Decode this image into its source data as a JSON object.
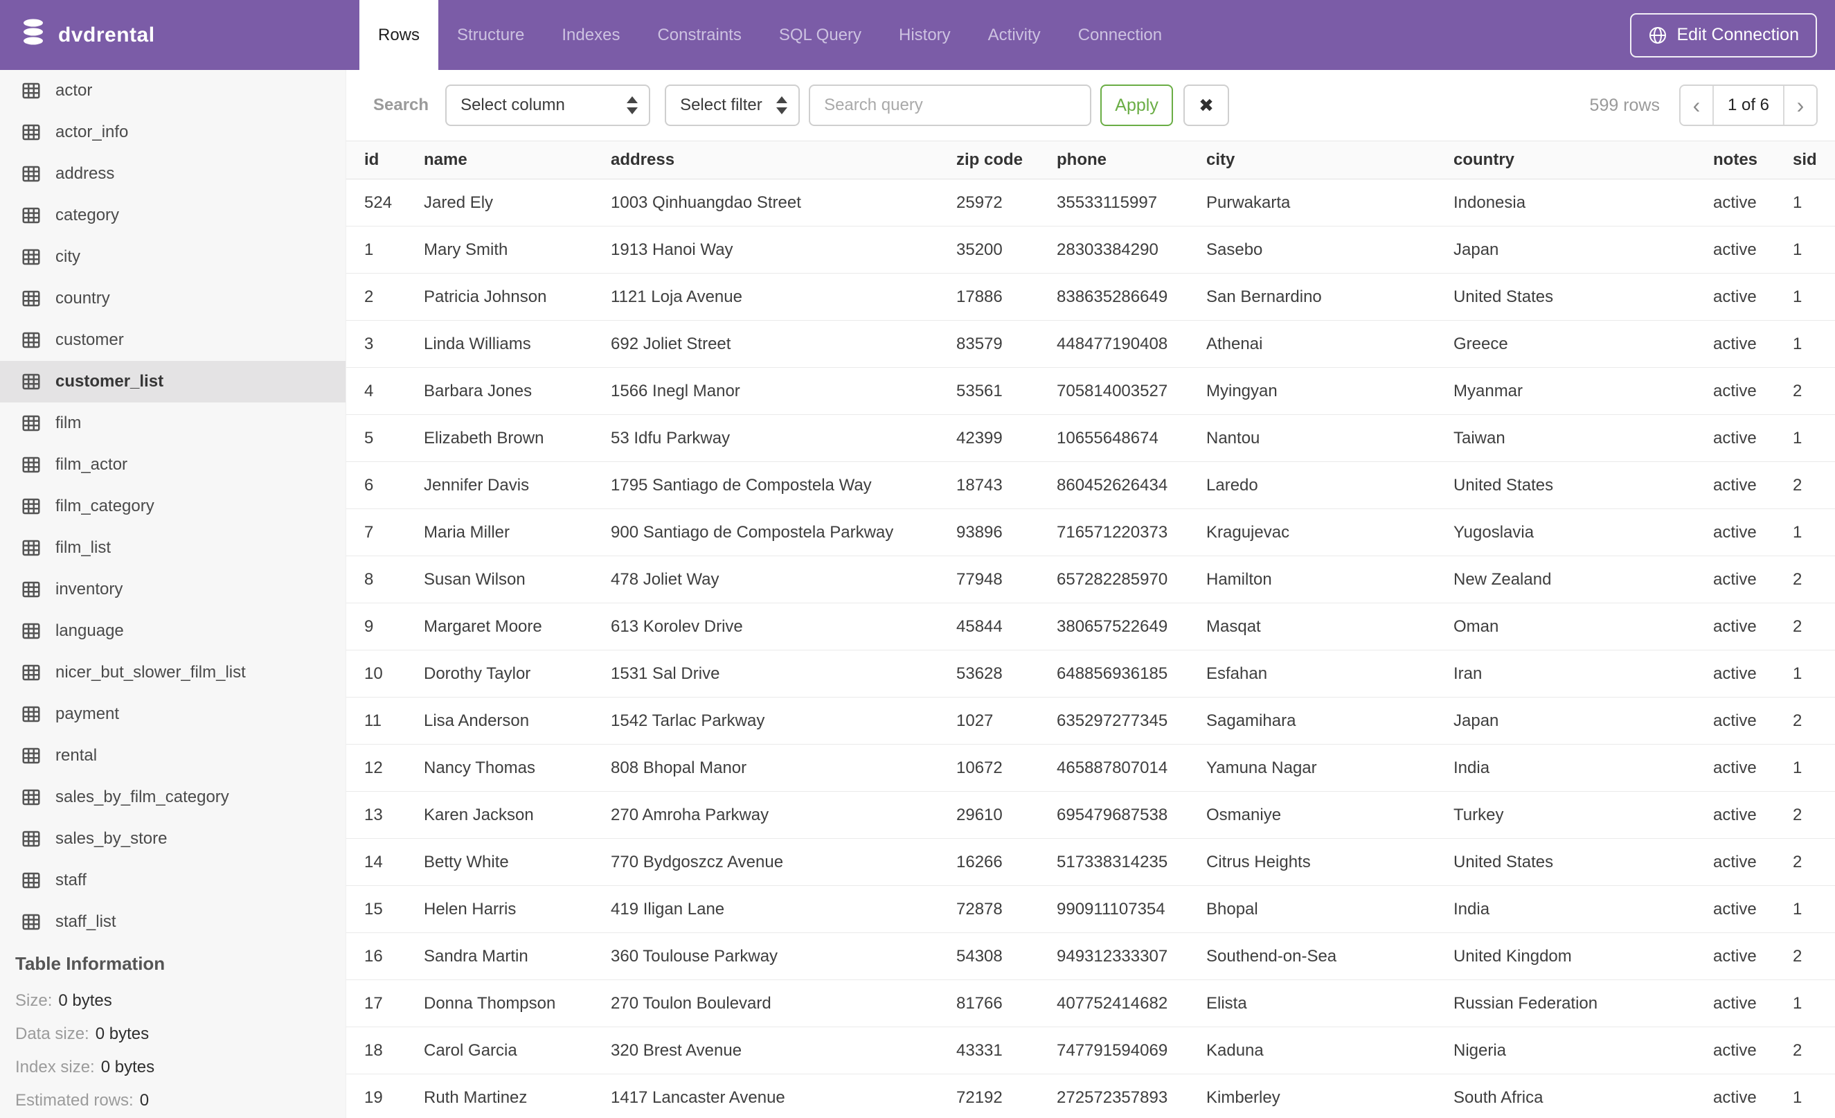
{
  "app": {
    "database_name": "dvdrental"
  },
  "colors": {
    "brand_purple": "#7b5ca7",
    "accent_green": "#6aad45"
  },
  "nav": {
    "tabs": [
      {
        "label": "Rows",
        "active": true
      },
      {
        "label": "Structure",
        "active": false
      },
      {
        "label": "Indexes",
        "active": false
      },
      {
        "label": "Constraints",
        "active": false
      },
      {
        "label": "SQL Query",
        "active": false
      },
      {
        "label": "History",
        "active": false
      },
      {
        "label": "Activity",
        "active": false
      },
      {
        "label": "Connection",
        "active": false
      }
    ],
    "edit_connection_label": "Edit Connection"
  },
  "sidebar": {
    "tables": [
      {
        "label": "actor",
        "selected": false
      },
      {
        "label": "actor_info",
        "selected": false
      },
      {
        "label": "address",
        "selected": false
      },
      {
        "label": "category",
        "selected": false
      },
      {
        "label": "city",
        "selected": false
      },
      {
        "label": "country",
        "selected": false
      },
      {
        "label": "customer",
        "selected": false
      },
      {
        "label": "customer_list",
        "selected": true
      },
      {
        "label": "film",
        "selected": false
      },
      {
        "label": "film_actor",
        "selected": false
      },
      {
        "label": "film_category",
        "selected": false
      },
      {
        "label": "film_list",
        "selected": false
      },
      {
        "label": "inventory",
        "selected": false
      },
      {
        "label": "language",
        "selected": false
      },
      {
        "label": "nicer_but_slower_film_list",
        "selected": false
      },
      {
        "label": "payment",
        "selected": false
      },
      {
        "label": "rental",
        "selected": false
      },
      {
        "label": "sales_by_film_category",
        "selected": false
      },
      {
        "label": "sales_by_store",
        "selected": false
      },
      {
        "label": "staff",
        "selected": false
      },
      {
        "label": "staff_list",
        "selected": false
      }
    ],
    "info": {
      "title": "Table Information",
      "stats": [
        {
          "label": "Size:",
          "value": "0 bytes"
        },
        {
          "label": "Data size:",
          "value": "0 bytes"
        },
        {
          "label": "Index size:",
          "value": "0 bytes"
        },
        {
          "label": "Estimated rows:",
          "value": "0"
        }
      ]
    }
  },
  "toolbar": {
    "search_label": "Search",
    "column_select_value": "Select column",
    "filter_select_value": "Select filter",
    "query_placeholder": "Search query",
    "apply_label": "Apply",
    "clear_icon": "✖",
    "rows_count": "599 rows",
    "pager": {
      "prev": "‹",
      "current": "1 of 6",
      "next": "›"
    }
  },
  "table": {
    "columns": [
      "id",
      "name",
      "address",
      "zip code",
      "phone",
      "city",
      "country",
      "notes",
      "sid"
    ],
    "rows": [
      {
        "id": "524",
        "name": "Jared Ely",
        "address": "1003 Qinhuangdao Street",
        "zip": "25972",
        "phone": "35533115997",
        "city": "Purwakarta",
        "country": "Indonesia",
        "notes": "active",
        "sid": "1"
      },
      {
        "id": "1",
        "name": "Mary Smith",
        "address": "1913 Hanoi Way",
        "zip": "35200",
        "phone": "28303384290",
        "city": "Sasebo",
        "country": "Japan",
        "notes": "active",
        "sid": "1"
      },
      {
        "id": "2",
        "name": "Patricia Johnson",
        "address": "1121 Loja Avenue",
        "zip": "17886",
        "phone": "838635286649",
        "city": "San Bernardino",
        "country": "United States",
        "notes": "active",
        "sid": "1"
      },
      {
        "id": "3",
        "name": "Linda Williams",
        "address": "692 Joliet Street",
        "zip": "83579",
        "phone": "448477190408",
        "city": "Athenai",
        "country": "Greece",
        "notes": "active",
        "sid": "1"
      },
      {
        "id": "4",
        "name": "Barbara Jones",
        "address": "1566 Inegl Manor",
        "zip": "53561",
        "phone": "705814003527",
        "city": "Myingyan",
        "country": "Myanmar",
        "notes": "active",
        "sid": "2"
      },
      {
        "id": "5",
        "name": "Elizabeth Brown",
        "address": "53 Idfu Parkway",
        "zip": "42399",
        "phone": "10655648674",
        "city": "Nantou",
        "country": "Taiwan",
        "notes": "active",
        "sid": "1"
      },
      {
        "id": "6",
        "name": "Jennifer Davis",
        "address": "1795 Santiago de Compostela Way",
        "zip": "18743",
        "phone": "860452626434",
        "city": "Laredo",
        "country": "United States",
        "notes": "active",
        "sid": "2"
      },
      {
        "id": "7",
        "name": "Maria Miller",
        "address": "900 Santiago de Compostela Parkway",
        "zip": "93896",
        "phone": "716571220373",
        "city": "Kragujevac",
        "country": "Yugoslavia",
        "notes": "active",
        "sid": "1"
      },
      {
        "id": "8",
        "name": "Susan Wilson",
        "address": "478 Joliet Way",
        "zip": "77948",
        "phone": "657282285970",
        "city": "Hamilton",
        "country": "New Zealand",
        "notes": "active",
        "sid": "2"
      },
      {
        "id": "9",
        "name": "Margaret Moore",
        "address": "613 Korolev Drive",
        "zip": "45844",
        "phone": "380657522649",
        "city": "Masqat",
        "country": "Oman",
        "notes": "active",
        "sid": "2"
      },
      {
        "id": "10",
        "name": "Dorothy Taylor",
        "address": "1531 Sal Drive",
        "zip": "53628",
        "phone": "648856936185",
        "city": "Esfahan",
        "country": "Iran",
        "notes": "active",
        "sid": "1"
      },
      {
        "id": "11",
        "name": "Lisa Anderson",
        "address": "1542 Tarlac Parkway",
        "zip": "1027",
        "phone": "635297277345",
        "city": "Sagamihara",
        "country": "Japan",
        "notes": "active",
        "sid": "2"
      },
      {
        "id": "12",
        "name": "Nancy Thomas",
        "address": "808 Bhopal Manor",
        "zip": "10672",
        "phone": "465887807014",
        "city": "Yamuna Nagar",
        "country": "India",
        "notes": "active",
        "sid": "1"
      },
      {
        "id": "13",
        "name": "Karen Jackson",
        "address": "270 Amroha Parkway",
        "zip": "29610",
        "phone": "695479687538",
        "city": "Osmaniye",
        "country": "Turkey",
        "notes": "active",
        "sid": "2"
      },
      {
        "id": "14",
        "name": "Betty White",
        "address": "770 Bydgoszcz Avenue",
        "zip": "16266",
        "phone": "517338314235",
        "city": "Citrus Heights",
        "country": "United States",
        "notes": "active",
        "sid": "2"
      },
      {
        "id": "15",
        "name": "Helen Harris",
        "address": "419 Iligan Lane",
        "zip": "72878",
        "phone": "990911107354",
        "city": "Bhopal",
        "country": "India",
        "notes": "active",
        "sid": "1"
      },
      {
        "id": "16",
        "name": "Sandra Martin",
        "address": "360 Toulouse Parkway",
        "zip": "54308",
        "phone": "949312333307",
        "city": "Southend-on-Sea",
        "country": "United Kingdom",
        "notes": "active",
        "sid": "2"
      },
      {
        "id": "17",
        "name": "Donna Thompson",
        "address": "270 Toulon Boulevard",
        "zip": "81766",
        "phone": "407752414682",
        "city": "Elista",
        "country": "Russian Federation",
        "notes": "active",
        "sid": "1"
      },
      {
        "id": "18",
        "name": "Carol Garcia",
        "address": "320 Brest Avenue",
        "zip": "43331",
        "phone": "747791594069",
        "city": "Kaduna",
        "country": "Nigeria",
        "notes": "active",
        "sid": "2"
      },
      {
        "id": "19",
        "name": "Ruth Martinez",
        "address": "1417 Lancaster Avenue",
        "zip": "72192",
        "phone": "272572357893",
        "city": "Kimberley",
        "country": "South Africa",
        "notes": "active",
        "sid": "1"
      }
    ]
  }
}
